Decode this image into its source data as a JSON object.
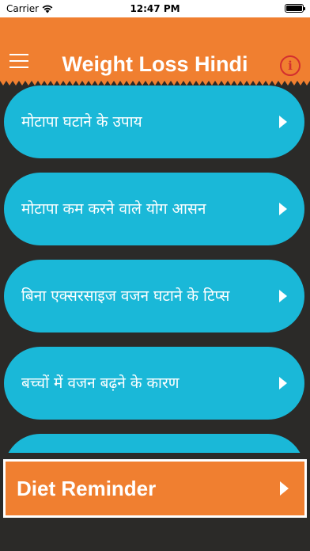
{
  "status_bar": {
    "carrier": "Carrier",
    "time": "12:47 PM"
  },
  "navbar": {
    "title": "Weight Loss Hindi",
    "info_symbol": "i"
  },
  "menu_items": [
    {
      "label": "मोटापा घटाने के उपाय"
    },
    {
      "label": "मोटापा कम करने वाले योग आसन"
    },
    {
      "label": "बिना एक्सरसाइज वजन घटाने के टिप्स"
    },
    {
      "label": "बच्चों में वजन बढ़ने के कारण"
    }
  ],
  "diet_reminder": {
    "label": "Diet Reminder"
  },
  "colors": {
    "accent": "#f07f30",
    "item_bg": "#1ab8d8",
    "background": "#2b2a28",
    "info": "#d32f2f"
  }
}
